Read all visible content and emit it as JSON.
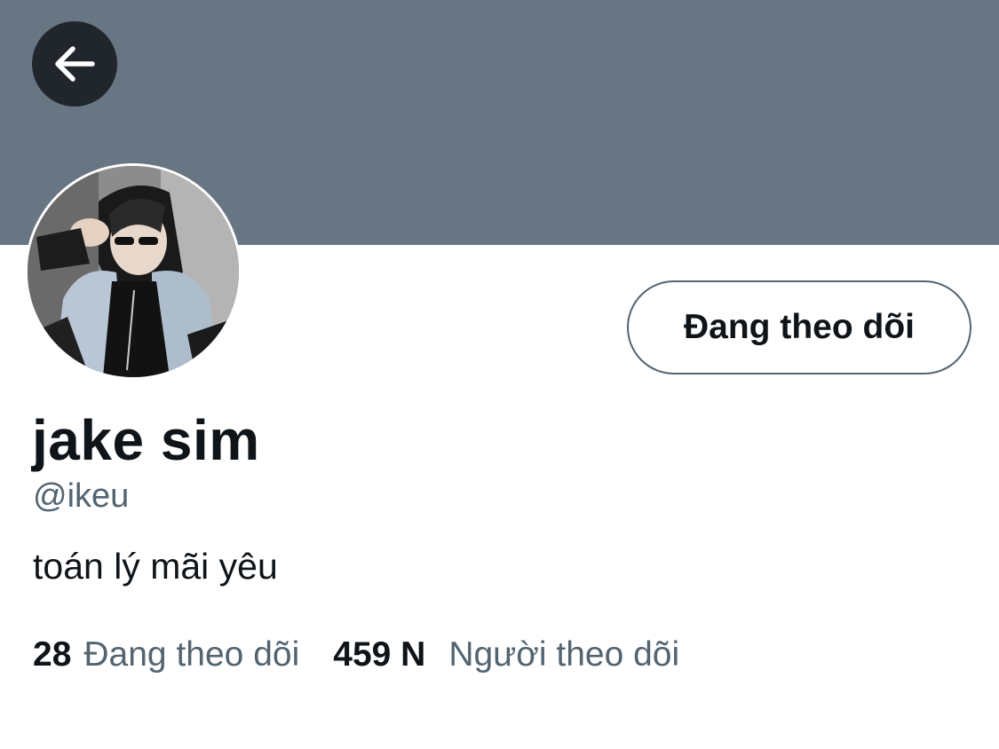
{
  "header": {
    "back_icon": "arrow-left-icon",
    "banner_color": "#687684",
    "back_button_color": "#20262c"
  },
  "profile": {
    "display_name": "jake sim",
    "handle": "@ikeu",
    "bio": "toán lý mãi yêu",
    "follow_button_label": "Đang theo dõi",
    "avatar": "profile-photo"
  },
  "stats": {
    "following_count": "28",
    "following_label": "Đang theo dõi",
    "followers_count": "459 N",
    "followers_label": "Người theo dõi"
  },
  "colors": {
    "text_primary": "#0f1419",
    "text_secondary": "#536471"
  }
}
